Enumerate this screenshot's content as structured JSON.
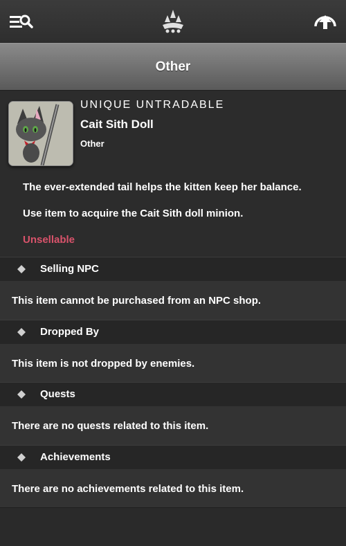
{
  "header": {
    "menu_icon": "search-menu-icon",
    "logo_icon": "guild-logo-icon",
    "home_icon": "home-arrow-icon"
  },
  "page": {
    "title": "Other"
  },
  "item": {
    "rarity": "UNIQUE UNTRADABLE",
    "name": "Cait Sith Doll",
    "category": "Other",
    "icon": "cait-sith-doll-image",
    "description": "The ever-extended tail helps the kitten keep her balance.",
    "usage": "Use item to acquire the Cait Sith doll minion.",
    "status": "Unsellable",
    "status_color": "#d9536b"
  },
  "sections": [
    {
      "label": "Selling NPC",
      "text": "This item cannot be purchased from an NPC shop."
    },
    {
      "label": "Dropped By",
      "text": "This item is not dropped by enemies."
    },
    {
      "label": "Quests",
      "text": "There are no quests related to this item."
    },
    {
      "label": "Achievements",
      "text": "There are no achievements related to this item."
    }
  ]
}
